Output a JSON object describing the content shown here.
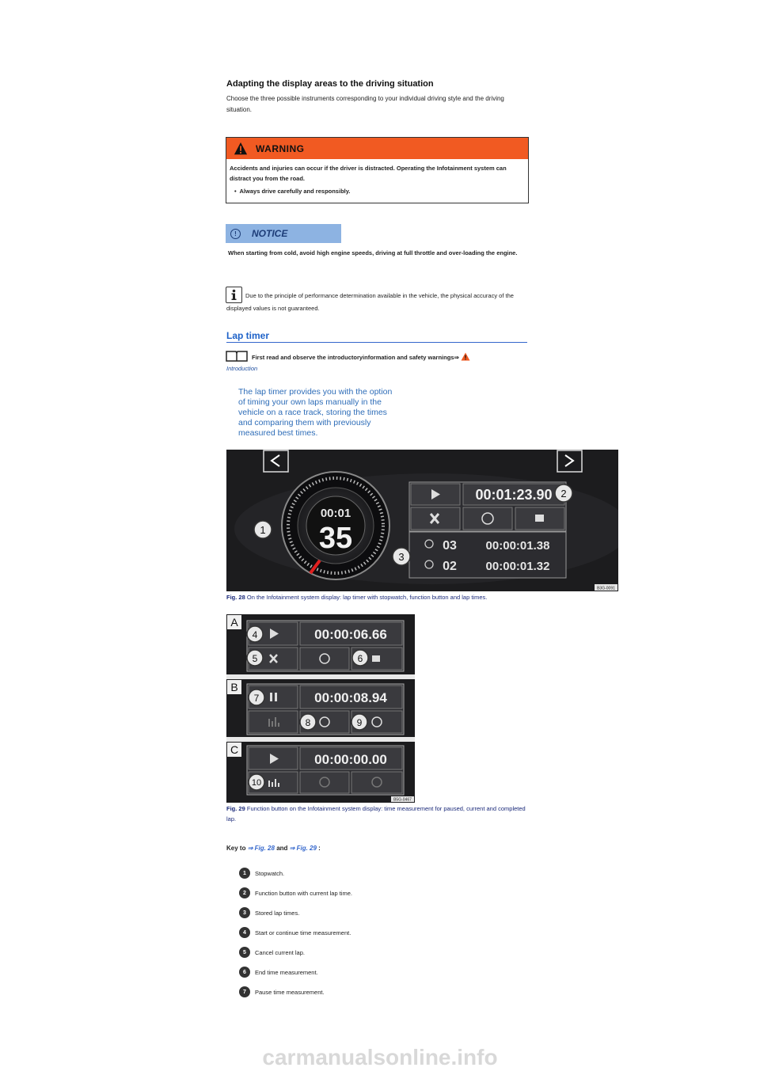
{
  "section_title": "Adapting the display areas to the driving situation",
  "intro_paragraph": "Choose the three possible instruments corresponding to your individual driving style and the driving situation.",
  "warning": {
    "title": "WARNING",
    "text": "Accidents and injuries can occur if the driver is distracted. Operating the Infotainment system can distract you from the road.",
    "bullet": "Always drive carefully and responsibly."
  },
  "notice": {
    "icon": "!",
    "title": "NOTICE",
    "text": "When starting from cold, avoid high engine speeds, driving at full throttle and over-loading the engine."
  },
  "info_note": "Due to the principle of performance determination available in the vehicle, the physical accuracy of the displayed values is not guaranteed.",
  "lap_timer": {
    "heading": "Lap timer",
    "read_first": "First read and observe the introductoryinformation and safety warnings⇒",
    "intro_link": "Introduction",
    "blue_intro": "The lap timer provides you with the option of timing your own laps manually in the vehicle on a race track, storing the times and comparing them with previously measured best times."
  },
  "fig28": {
    "stopwatch_top": "00:01",
    "stopwatch_big": "35",
    "current_time": "00:01:23.90",
    "laps": [
      {
        "num": "03",
        "time": "00:00:01.38"
      },
      {
        "num": "02",
        "time": "00:00:01.32"
      }
    ],
    "callouts": [
      "1",
      "2",
      "3"
    ],
    "code": "B3G-0091",
    "caption_label": "Fig. 28",
    "caption_text": "On the Infotainment system display: lap timer with stopwatch, function button and lap times."
  },
  "fig29": {
    "panels": [
      {
        "letter": "A",
        "time": "00:00:06.66"
      },
      {
        "letter": "B",
        "time": "00:00:08.94"
      },
      {
        "letter": "C",
        "time": "00:00:00.00"
      }
    ],
    "callouts": [
      "4",
      "5",
      "6",
      "7",
      "8",
      "9",
      "10"
    ],
    "code": "B5G-0467",
    "caption_label": "Fig. 29",
    "caption_text": "Function button on the Infotainment system display: time measurement for paused, current and completed lap."
  },
  "key": {
    "prefix": "Key to",
    "ref1": "⇒ Fig. 28",
    "and": "and",
    "ref2": "⇒ Fig. 29",
    "suffix": ":",
    "items": [
      {
        "num": "1",
        "text": "Stopwatch."
      },
      {
        "num": "2",
        "text": "Function button with current lap time."
      },
      {
        "num": "3",
        "text": "Stored lap times."
      },
      {
        "num": "4",
        "text": "Start or continue time measurement."
      },
      {
        "num": "5",
        "text": "Cancel current lap."
      },
      {
        "num": "6",
        "text": "End time measurement."
      },
      {
        "num": "7",
        "text": "Pause time measurement."
      }
    ]
  },
  "watermark": "carmanualsonline.info"
}
